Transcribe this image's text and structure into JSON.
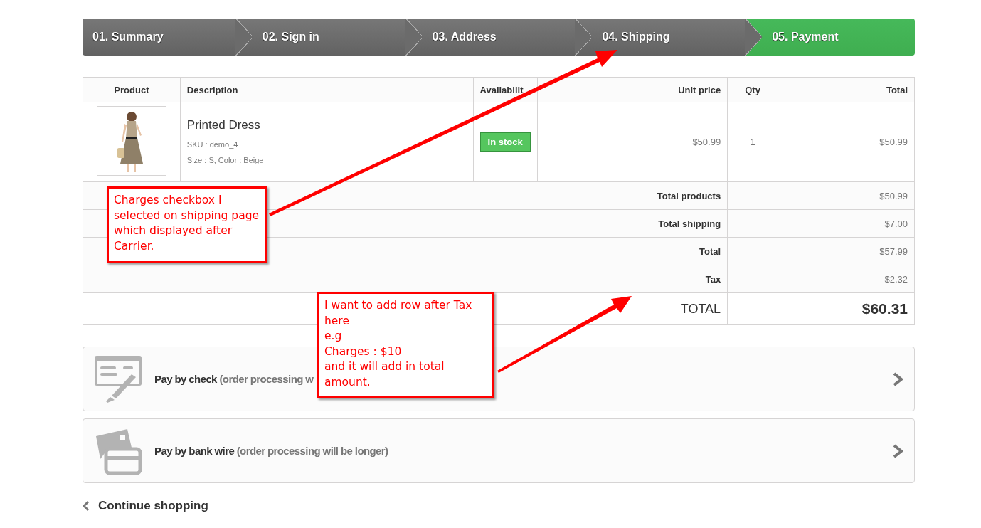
{
  "steps": [
    {
      "label": "01. Summary",
      "selected": false
    },
    {
      "label": "02. Sign in",
      "selected": false
    },
    {
      "label": "03. Address",
      "selected": false
    },
    {
      "label": "04. Shipping",
      "selected": false
    },
    {
      "label": "05. Payment",
      "selected": true
    }
  ],
  "cart": {
    "columns": [
      "Product",
      "Description",
      "Availabilit",
      "Unit price",
      "Qty",
      "Total"
    ],
    "rows": [
      {
        "name": "Printed Dress",
        "sku": "SKU : demo_4",
        "attributes": "Size : S, Color : Beige",
        "availability": "In stock",
        "unit_price": "$50.99",
        "qty": "1",
        "total": "$50.99"
      }
    ],
    "summary": [
      {
        "kind": "normal",
        "label": "Total products",
        "value": "$50.99"
      },
      {
        "kind": "normal",
        "label": "Total shipping",
        "value": "$7.00"
      },
      {
        "kind": "normal",
        "label": "Total",
        "value": "$57.99"
      },
      {
        "kind": "normal",
        "label": "Tax",
        "value": "$2.32"
      },
      {
        "kind": "grand",
        "label": "TOTAL",
        "value": "$60.31"
      }
    ]
  },
  "payment_options": [
    {
      "kind": "check",
      "title": "Pay by check",
      "note": "(order processing w"
    },
    {
      "kind": "bank_wire",
      "title": "Pay by bank wire",
      "note": "(order processing will be longer)"
    }
  ],
  "continue_link": "Continue shopping",
  "annotations": [
    {
      "text": "Charges checkbox I\nselected on shipping page\nwhich displayed after\nCarrier."
    },
    {
      "text": "I want to add row after Tax\nhere\ne.g\nCharges : $10\nand it will add in total\namount."
    }
  ]
}
